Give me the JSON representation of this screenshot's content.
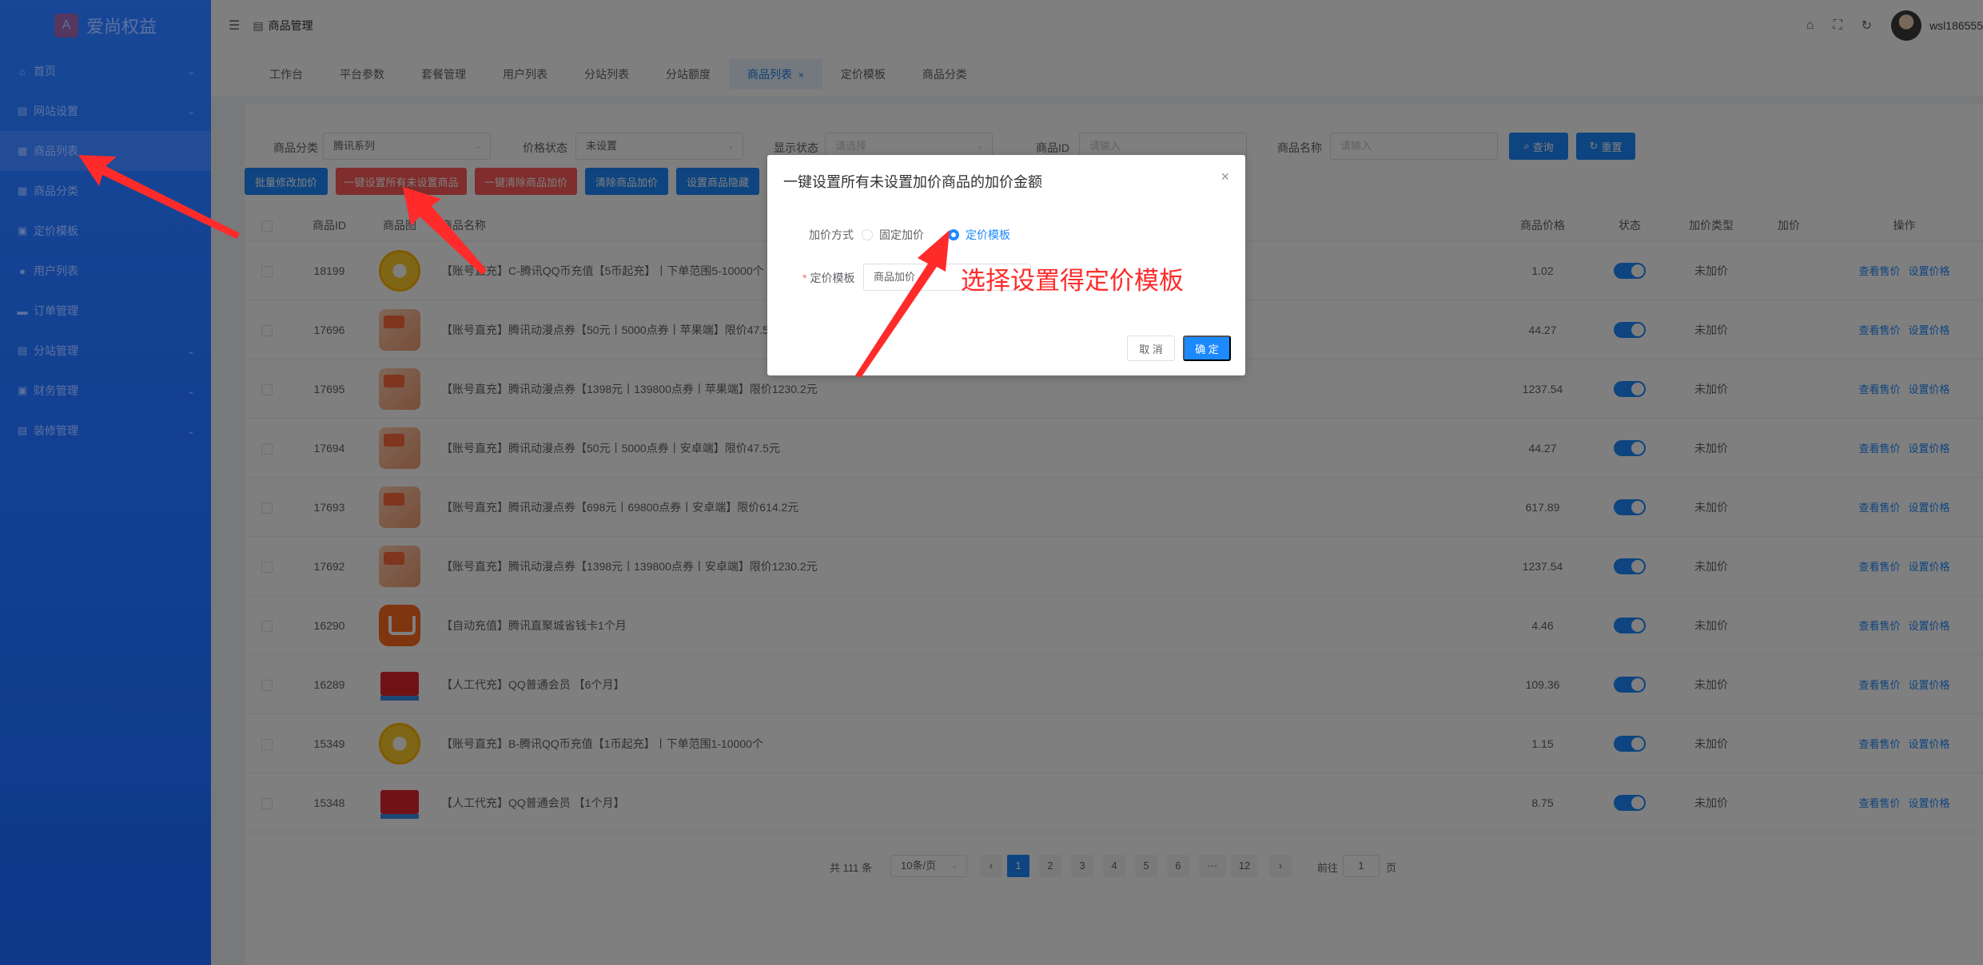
{
  "app": {
    "logo_text": "爱尚权益",
    "logo_glyph": "A"
  },
  "sidebar": {
    "items": [
      {
        "label": "首页",
        "icon": "home-icon",
        "glyph": "⌂",
        "has_children": true
      },
      {
        "label": "网站设置",
        "icon": "monitor-icon",
        "glyph": "▤",
        "has_children": true
      },
      {
        "label": "商品列表",
        "icon": "list-icon",
        "glyph": "▦",
        "has_children": false,
        "active": true
      },
      {
        "label": "商品分类",
        "icon": "grid-icon",
        "glyph": "▦",
        "has_children": false
      },
      {
        "label": "定价模板",
        "icon": "template-icon",
        "glyph": "▣",
        "has_children": false
      },
      {
        "label": "用户列表",
        "icon": "user-icon",
        "glyph": "●",
        "has_children": false
      },
      {
        "label": "订单管理",
        "icon": "cart-icon",
        "glyph": "▬",
        "has_children": false
      },
      {
        "label": "分站管理",
        "icon": "station-icon",
        "glyph": "▤",
        "has_children": true
      },
      {
        "label": "财务管理",
        "icon": "finance-icon",
        "glyph": "▣",
        "has_children": true
      },
      {
        "label": "装修管理",
        "icon": "decor-icon",
        "glyph": "▤",
        "has_children": true
      }
    ]
  },
  "topbar": {
    "breadcrumb": "商品管理",
    "username": "wsl186555"
  },
  "tabs": [
    {
      "label": "工作台"
    },
    {
      "label": "平台参数"
    },
    {
      "label": "套餐管理"
    },
    {
      "label": "用户列表"
    },
    {
      "label": "分站列表"
    },
    {
      "label": "分站额度"
    },
    {
      "label": "商品列表",
      "active": true,
      "close": "×"
    },
    {
      "label": "定价模板"
    },
    {
      "label": "商品分类"
    }
  ],
  "filters": {
    "category_label": "商品分类",
    "category_value": "腾讯系列",
    "price_status_label": "价格状态",
    "price_status_value": "未设置",
    "display_status_label": "显示状态",
    "display_status_placeholder": "请选择",
    "product_id_label": "商品ID",
    "product_id_placeholder": "请输入",
    "product_name_label": "商品名称",
    "product_name_placeholder": "请输入",
    "query_button": "查询",
    "reset_button": "重置"
  },
  "actions": {
    "batch_edit": "批量修改加价",
    "set_all_unset": "一键设置所有未设置商品",
    "clear_all": "一键清除商品加价",
    "clear_markup": "清除商品加价",
    "set_hidden": "设置商品隐藏"
  },
  "table": {
    "headers": {
      "id": "商品ID",
      "image": "商品图",
      "name": "商品名称",
      "price": "商品价格",
      "status": "状态",
      "markup_type": "加价类型",
      "markup": "加价",
      "ops": "操作"
    },
    "rows": [
      {
        "id": "18199",
        "image": "qq",
        "name": "【账号直充】C-腾讯QQ币充值【5币起充】丨下单范围5-10000个",
        "price": "1.02",
        "markup_type": "未加价",
        "enabled": true
      },
      {
        "id": "17696",
        "image": "dm",
        "name": "【账号直充】腾讯动漫点券【50元丨5000点券丨苹果端】限价47.5元",
        "price": "44.27",
        "markup_type": "未加价",
        "enabled": true
      },
      {
        "id": "17695",
        "image": "dm",
        "name": "【账号直充】腾讯动漫点券【1398元丨139800点券丨苹果端】限价1230.2元",
        "price": "1237.54",
        "markup_type": "未加价",
        "enabled": true
      },
      {
        "id": "17694",
        "image": "dm",
        "name": "【账号直充】腾讯动漫点券【50元丨5000点券丨安卓端】限价47.5元",
        "price": "44.27",
        "markup_type": "未加价",
        "enabled": true
      },
      {
        "id": "17693",
        "image": "dm",
        "name": "【账号直充】腾讯动漫点券【698元丨69800点券丨安卓端】限价614.2元",
        "price": "617.89",
        "markup_type": "未加价",
        "enabled": true
      },
      {
        "id": "17692",
        "image": "dm",
        "name": "【账号直充】腾讯动漫点券【1398元丨139800点券丨安卓端】限价1230.2元",
        "price": "1237.54",
        "markup_type": "未加价",
        "enabled": true
      },
      {
        "id": "16290",
        "image": "cart",
        "name": "【自动充值】腾讯直聚城省钱卡1个月",
        "price": "4.46",
        "markup_type": "未加价",
        "enabled": true
      },
      {
        "id": "16289",
        "image": "vip",
        "name": "【人工代充】QQ普通会员 【6个月】",
        "price": "109.36",
        "markup_type": "未加价",
        "enabled": true
      },
      {
        "id": "15349",
        "image": "qq",
        "name": "【账号直充】B-腾讯QQ币充值【1币起充】丨下单范围1-10000个",
        "price": "1.15",
        "markup_type": "未加价",
        "enabled": true
      },
      {
        "id": "15348",
        "image": "vip",
        "name": "【人工代充】QQ普通会员 【1个月】",
        "price": "8.75",
        "markup_type": "未加价",
        "enabled": true
      }
    ],
    "op_view": "查看售价",
    "op_set": "设置价格"
  },
  "pagination": {
    "total_text": "共 111 条",
    "page_size": "10条/页",
    "pages": [
      "1",
      "2",
      "3",
      "4",
      "5",
      "6",
      "···",
      "12"
    ],
    "current": "1",
    "goto_label": "前往",
    "goto_value": "1",
    "goto_suffix": "页"
  },
  "dialog": {
    "title": "一键设置所有未设置加价商品的加价金额",
    "method_label": "加价方式",
    "option_fixed": "固定加价",
    "option_template": "定价模板",
    "selected": "定价模板",
    "template_label": "定价模板",
    "template_value": "商品加价",
    "cancel": "取 消",
    "confirm": "确 定"
  },
  "annotation": {
    "text": "选择设置得定价模板",
    "color": "#ff2b2b"
  },
  "colors": {
    "primary": "#1d89ff",
    "danger": "#ff5a5a",
    "sidebar": "#1a63d3",
    "annotation": "#ff2b2b"
  }
}
